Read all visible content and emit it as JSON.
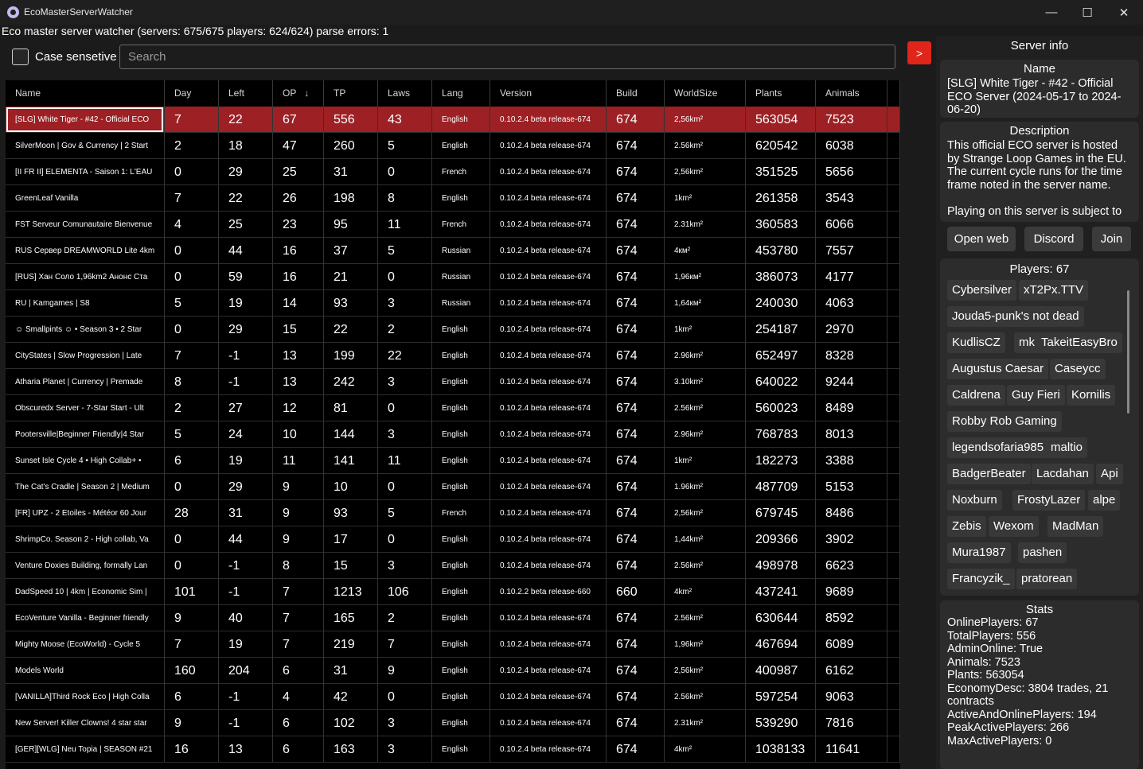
{
  "window": {
    "title": "EcoMasterServerWatcher",
    "min_glyph": "—",
    "max_glyph": "☐",
    "close_glyph": "✕"
  },
  "header": {
    "status": "Eco master server watcher (servers: 675/675 players: 624/624) parse errors: 1"
  },
  "toolbar": {
    "case_label": "Case sensetive",
    "search_placeholder": "Search",
    "toggle_label": ">"
  },
  "table": {
    "columns": [
      "Name",
      "Day",
      "Left",
      "OP",
      "TP",
      "Laws",
      "Lang",
      "Version",
      "Build",
      "WorldSize",
      "Plants",
      "Animals"
    ],
    "sort_glyph": "↓",
    "rows": [
      [
        "[SLG] White Tiger - #42 - Official ECO",
        "7",
        "22",
        "67",
        "556",
        "43",
        "English",
        "0.10.2.4 beta release-674",
        "674",
        "2,56km²",
        "563054",
        "7523"
      ],
      [
        "SilverMoon | Gov & Currency | 2 Start",
        "2",
        "18",
        "47",
        "260",
        "5",
        "English",
        "0.10.2.4 beta release-674",
        "674",
        "2.56km²",
        "620542",
        "6038"
      ],
      [
        "[II FR II] ELEMENTA - Saison 1: L'EAU",
        "0",
        "29",
        "25",
        "31",
        "0",
        "French",
        "0.10.2.4 beta release-674",
        "674",
        "2,56km²",
        "351525",
        "5656"
      ],
      [
        "GreenLeaf Vanilla",
        "7",
        "22",
        "26",
        "198",
        "8",
        "English",
        "0.10.2.4 beta release-674",
        "674",
        "1km²",
        "261358",
        "3543"
      ],
      [
        "FST Serveur Comunautaire Bienvenue",
        "4",
        "25",
        "23",
        "95",
        "11",
        "French",
        "0.10.2.4 beta release-674",
        "674",
        "2.31km²",
        "360583",
        "6066"
      ],
      [
        "RUS Сервер DREAMWORLD Lite 4km",
        "0",
        "44",
        "16",
        "37",
        "5",
        "Russian",
        "0.10.2.4 beta release-674",
        "674",
        "4км²",
        "453780",
        "7557"
      ],
      [
        "[RUS] Хан Соло 1,96km2 Анонс Ста",
        "0",
        "59",
        "16",
        "21",
        "0",
        "Russian",
        "0.10.2.4 beta release-674",
        "674",
        "1,96км²",
        "386073",
        "4177"
      ],
      [
        "RU | Kamgames | S8",
        "5",
        "19",
        "14",
        "93",
        "3",
        "Russian",
        "0.10.2.4 beta release-674",
        "674",
        "1,64км²",
        "240030",
        "4063"
      ],
      [
        "☺ Smallpints ☺ • Season 3 • 2 Star",
        "0",
        "29",
        "15",
        "22",
        "2",
        "English",
        "0.10.2.4 beta release-674",
        "674",
        "1km²",
        "254187",
        "2970"
      ],
      [
        "CityStates | Slow Progression | Late",
        "7",
        "-1",
        "13",
        "199",
        "22",
        "English",
        "0.10.2.4 beta release-674",
        "674",
        "2.96km²",
        "652497",
        "8328"
      ],
      [
        "Atharia Planet | Currency | Premade",
        "8",
        "-1",
        "13",
        "242",
        "3",
        "English",
        "0.10.2.4 beta release-674",
        "674",
        "3.10km²",
        "640022",
        "9244"
      ],
      [
        "Obscuredx Server - 7-Star Start - Ult",
        "2",
        "27",
        "12",
        "81",
        "0",
        "English",
        "0.10.2.4 beta release-674",
        "674",
        "2.56km²",
        "560023",
        "8489"
      ],
      [
        "Pootersville|Beginner Friendly|4 Star",
        "5",
        "24",
        "10",
        "144",
        "3",
        "English",
        "0.10.2.4 beta release-674",
        "674",
        "2.96km²",
        "768783",
        "8013"
      ],
      [
        "Sunset Isle Cycle 4 • High Collab+ •",
        "6",
        "19",
        "11",
        "141",
        "11",
        "English",
        "0.10.2.4 beta release-674",
        "674",
        "1km²",
        "182273",
        "3388"
      ],
      [
        "The Cat's Cradle | Season 2 | Medium",
        "0",
        "29",
        "9",
        "10",
        "0",
        "English",
        "0.10.2.4 beta release-674",
        "674",
        "1.96km²",
        "487709",
        "5153"
      ],
      [
        "[FR] UPZ - 2 Etoiles - Météor 60 Jour",
        "28",
        "31",
        "9",
        "93",
        "5",
        "French",
        "0.10.2.4 beta release-674",
        "674",
        "2,56km²",
        "679745",
        "8486"
      ],
      [
        "ShrimpCo. Season 2 - High collab, Va",
        "0",
        "44",
        "9",
        "17",
        "0",
        "English",
        "0.10.2.4 beta release-674",
        "674",
        "1,44km²",
        "209366",
        "3902"
      ],
      [
        "Venture Doxies Building, formally Lan",
        "0",
        "-1",
        "8",
        "15",
        "3",
        "English",
        "0.10.2.4 beta release-674",
        "674",
        "2.56km²",
        "498978",
        "6623"
      ],
      [
        "DadSpeed 10 | 4km | Economic Sim |",
        "101",
        "-1",
        "7",
        "1213",
        "106",
        "English",
        "0.10.2.2 beta release-660",
        "660",
        "4km²",
        "437241",
        "9689"
      ],
      [
        "EcoVenture Vanilla - Beginner friendly",
        "9",
        "40",
        "7",
        "165",
        "2",
        "English",
        "0.10.2.4 beta release-674",
        "674",
        "2.56km²",
        "630644",
        "8592"
      ],
      [
        "Mighty Moose (EcoWorld) - Cycle 5",
        "7",
        "19",
        "7",
        "219",
        "7",
        "English",
        "0.10.2.4 beta release-674",
        "674",
        "1,96km²",
        "467694",
        "6089"
      ],
      [
        "Models World",
        "160",
        "204",
        "6",
        "31",
        "9",
        "English",
        "0.10.2.4 beta release-674",
        "674",
        "2,56km²",
        "400987",
        "6162"
      ],
      [
        "[VANILLA]Third Rock Eco | High Colla",
        "6",
        "-1",
        "4",
        "42",
        "0",
        "English",
        "0.10.2.4 beta release-674",
        "674",
        "2.56km²",
        "597254",
        "9063"
      ],
      [
        "New Server! Killer Clowns! 4 star star",
        "9",
        "-1",
        "6",
        "102",
        "3",
        "English",
        "0.10.2.4 beta release-674",
        "674",
        "2.31km²",
        "539290",
        "7816"
      ],
      [
        "[GER][WLG] Neu Topia | SEASON #21",
        "16",
        "13",
        "6",
        "163",
        "3",
        "English",
        "0.10.2.4 beta release-674",
        "674",
        "4km²",
        "1038133",
        "11641"
      ]
    ]
  },
  "server_info": {
    "title": "Server info",
    "name_title": "Name",
    "name": "[SLG] White Tiger - #42 - Official ECO Server (2024-05-17 to 2024-06-20)",
    "description_title": "Description",
    "description": "This official ECO server is hosted by Strange Loop Games in the EU. The current cycle runs for the time frame noted in the server name.",
    "description_more": "Playing on this server is subject to",
    "buttons": {
      "open_web": "Open web",
      "discord": "Discord",
      "join": "Join"
    },
    "players_title": "Players: 67",
    "players": [
      "Cybersilver",
      "xT2Px.TTV",
      "Jouda5-punk's not dead",
      "KudlisCZ",
      "mk",
      "TakeitEasyBro",
      "Augustus Caesar",
      "Caseycc",
      "Caldrena",
      "Guy Fieri",
      "Kornilis",
      "Robby Rob Gaming",
      "legendsofaria985",
      "maltio",
      "BadgerBeater",
      "Lacdahan",
      "Api",
      "Noxburn",
      "FrostyLazer",
      "alpe",
      "Zebis",
      "Wexom",
      "MadMan",
      "Mura1987",
      "pashen",
      "Francyzik_",
      "pratorean"
    ],
    "stats_title": "Stats",
    "stats": [
      "OnlinePlayers: 67",
      "TotalPlayers: 556",
      "AdminOnline: True",
      "Animals: 7523",
      "Plants: 563054",
      "EconomyDesc: 3804 trades, 21 contracts",
      "ActiveAndOnlinePlayers: 194",
      "PeakActivePlayers: 266",
      "MaxActivePlayers: 0"
    ]
  },
  "colors": {
    "selected_row": "#9c2024",
    "accent_button": "#e0251a"
  }
}
